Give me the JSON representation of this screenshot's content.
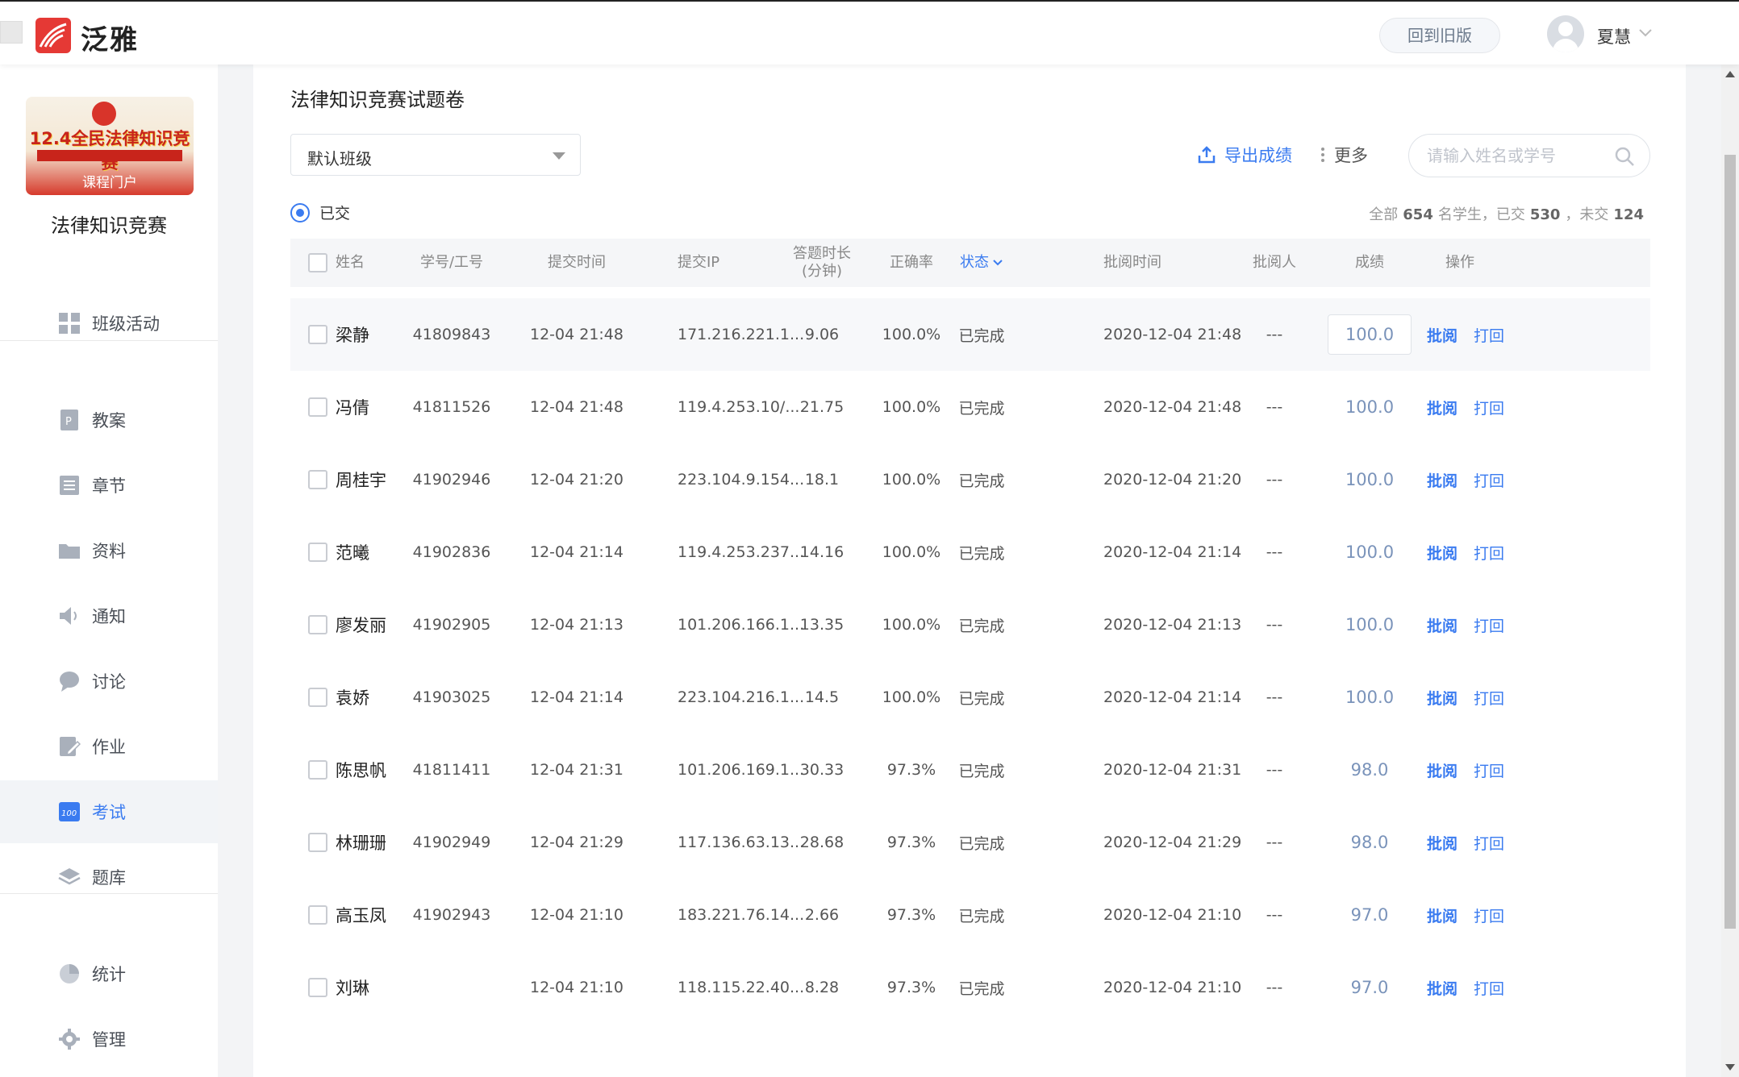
{
  "header": {
    "logo_text": "泛雅",
    "back_button": "回到旧版",
    "user_name": "夏慧"
  },
  "sidebar": {
    "banner_title": "12.4全民法律知识竞赛",
    "banner_portal": "课程门户",
    "course_name": "法律知识竞赛",
    "items": [
      {
        "label": "班级活动",
        "icon": "grid-icon"
      },
      {
        "label": "教案",
        "icon": "lesson-plan-icon"
      },
      {
        "label": "章节",
        "icon": "chapter-list-icon"
      },
      {
        "label": "资料",
        "icon": "folder-icon"
      },
      {
        "label": "通知",
        "icon": "speaker-icon"
      },
      {
        "label": "讨论",
        "icon": "chat-bubble-icon"
      },
      {
        "label": "作业",
        "icon": "edit-doc-icon"
      },
      {
        "label": "考试",
        "icon": "exam-100-icon"
      },
      {
        "label": "题库",
        "icon": "layers-icon"
      },
      {
        "label": "统计",
        "icon": "pie-chart-icon"
      },
      {
        "label": "管理",
        "icon": "gear-icon"
      }
    ],
    "active_index": 7
  },
  "main": {
    "title": "法律知识竞赛试题卷",
    "class_select": "默认班级",
    "export_label": "导出成绩",
    "more_label": "更多",
    "search_placeholder": "请输入姓名或学号",
    "radio_label": "已交",
    "summary": {
      "prefix": "全部",
      "total": "654",
      "mid1": "名学生，已交",
      "submitted": "530",
      "mid2": "，未交",
      "unsubmitted": "124"
    }
  },
  "table": {
    "headers": {
      "name": "姓名",
      "id": "学号/工号",
      "submit_time": "提交时间",
      "submit_ip": "提交IP",
      "duration": "答题时长",
      "duration_unit": "(分钟)",
      "accuracy": "正确率",
      "status": "状态",
      "review_time": "批阅时间",
      "reviewer": "批阅人",
      "score": "成绩",
      "actions": "操作"
    },
    "action_review": "批阅",
    "action_return": "打回",
    "rows": [
      {
        "name": "梁静",
        "id": "41809843",
        "submit_time": "12-04 21:48",
        "ip": "171.216.221.1...",
        "duration": "9.06",
        "accuracy": "100.0%",
        "status": "已完成",
        "review_time": "2020-12-04 21:48",
        "reviewer": "---",
        "score": "100.0"
      },
      {
        "name": "冯倩",
        "id": "41811526",
        "submit_time": "12-04 21:48",
        "ip": "119.4.253.10/...",
        "duration": "21.75",
        "accuracy": "100.0%",
        "status": "已完成",
        "review_time": "2020-12-04 21:48",
        "reviewer": "---",
        "score": "100.0"
      },
      {
        "name": "周桂宇",
        "id": "41902946",
        "submit_time": "12-04 21:20",
        "ip": "223.104.9.154...",
        "duration": "18.1",
        "accuracy": "100.0%",
        "status": "已完成",
        "review_time": "2020-12-04 21:20",
        "reviewer": "---",
        "score": "100.0"
      },
      {
        "name": "范曦",
        "id": "41902836",
        "submit_time": "12-04 21:14",
        "ip": "119.4.253.237...",
        "duration": "14.16",
        "accuracy": "100.0%",
        "status": "已完成",
        "review_time": "2020-12-04 21:14",
        "reviewer": "---",
        "score": "100.0"
      },
      {
        "name": "廖发丽",
        "id": "41902905",
        "submit_time": "12-04 21:13",
        "ip": "101.206.166.1...",
        "duration": "13.35",
        "accuracy": "100.0%",
        "status": "已完成",
        "review_time": "2020-12-04 21:13",
        "reviewer": "---",
        "score": "100.0"
      },
      {
        "name": "袁娇",
        "id": "41903025",
        "submit_time": "12-04 21:14",
        "ip": "223.104.216.1...",
        "duration": "14.5",
        "accuracy": "100.0%",
        "status": "已完成",
        "review_time": "2020-12-04 21:14",
        "reviewer": "---",
        "score": "100.0"
      },
      {
        "name": "陈思帆",
        "id": "41811411",
        "submit_time": "12-04 21:31",
        "ip": "101.206.169.1...",
        "duration": "30.33",
        "accuracy": "97.3%",
        "status": "已完成",
        "review_time": "2020-12-04 21:31",
        "reviewer": "---",
        "score": "98.0"
      },
      {
        "name": "林珊珊",
        "id": "41902949",
        "submit_time": "12-04 21:29",
        "ip": "117.136.63.13...",
        "duration": "28.68",
        "accuracy": "97.3%",
        "status": "已完成",
        "review_time": "2020-12-04 21:29",
        "reviewer": "---",
        "score": "98.0"
      },
      {
        "name": "高玉凤",
        "id": "41902943",
        "submit_time": "12-04 21:10",
        "ip": "183.221.76.14...",
        "duration": "2.66",
        "accuracy": "97.3%",
        "status": "已完成",
        "review_time": "2020-12-04 21:10",
        "reviewer": "---",
        "score": "97.0"
      },
      {
        "name": "刘琳",
        "id": "",
        "submit_time": "12-04 21:10",
        "ip": "118.115.22.40...",
        "duration": "8.28",
        "accuracy": "97.3%",
        "status": "已完成",
        "review_time": "2020-12-04 21:10",
        "reviewer": "---",
        "score": "97.0"
      }
    ]
  },
  "colors": {
    "accent": "#3a7bf0",
    "brand_red": "#e53935",
    "score_text": "#7a93ba"
  }
}
